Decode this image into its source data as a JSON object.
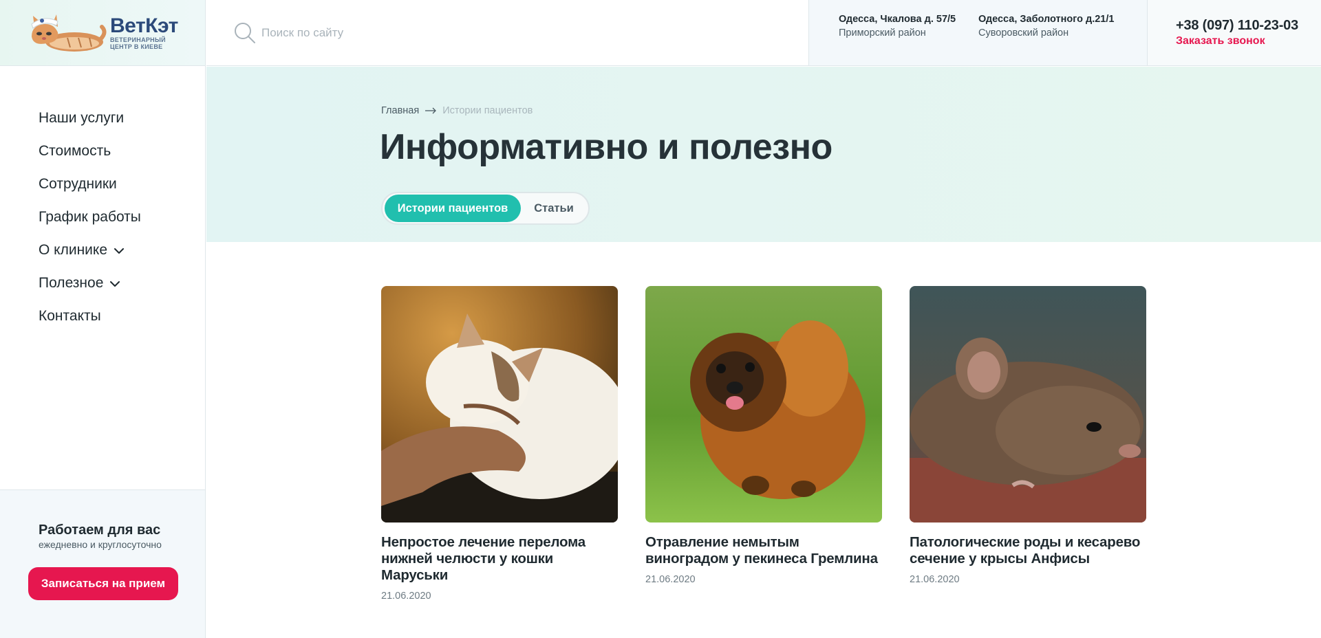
{
  "header": {
    "logo": {
      "name": "ВетКэт",
      "tagline_line1": "ВЕТЕРИНАРНЫЙ",
      "tagline_line2": "ЦЕНТР В КИЕВЕ"
    },
    "search": {
      "placeholder": "Поиск по сайту",
      "icon": "search-icon"
    },
    "addresses": [
      {
        "street": "Одесса, Чкалова д. 57/5",
        "district": "Приморский район"
      },
      {
        "street": "Одесса, Заболотного д.21/1",
        "district": "Суворовский район"
      }
    ],
    "phone": "+38 (097) 110-23-03",
    "callback_label": "Заказать звонок"
  },
  "sidebar": {
    "nav": [
      {
        "label": "Наши услуги",
        "has_dropdown": false
      },
      {
        "label": "Стоимость",
        "has_dropdown": false
      },
      {
        "label": "Сотрудники",
        "has_dropdown": false
      },
      {
        "label": "График работы",
        "has_dropdown": false
      },
      {
        "label": "О клинике",
        "has_dropdown": true
      },
      {
        "label": "Полезное",
        "has_dropdown": true
      },
      {
        "label": "Контакты",
        "has_dropdown": false
      }
    ],
    "works_title": "Работаем для вас",
    "works_subtitle": "ежедневно и круглосуточно",
    "appointment_button": "Записаться на прием"
  },
  "hero": {
    "breadcrumb": {
      "home": "Главная",
      "current": "Истории пациентов"
    },
    "title": "Информативно и полезно",
    "tabs": [
      {
        "label": "Истории пациентов",
        "active": true
      },
      {
        "label": "Статьи",
        "active": false
      }
    ]
  },
  "cards": [
    {
      "title": "Непростое лечение перелома нижней челюсти у кошки Маруськи",
      "date": "21.06.2020",
      "image": "cat-photo"
    },
    {
      "title": "Отравление немытым виноградом у пекинеса Гремлина",
      "date": "21.06.2020",
      "image": "pekingese-dog-photo"
    },
    {
      "title": "Патологические роды и кесарево сечение у крысы Анфисы",
      "date": "21.06.2020",
      "image": "rat-photo"
    }
  ],
  "colors": {
    "accent_red": "#e6174f",
    "accent_teal": "#21bfae",
    "hero_bg": "#e2f4f3",
    "text_dark": "#1f2a30"
  }
}
